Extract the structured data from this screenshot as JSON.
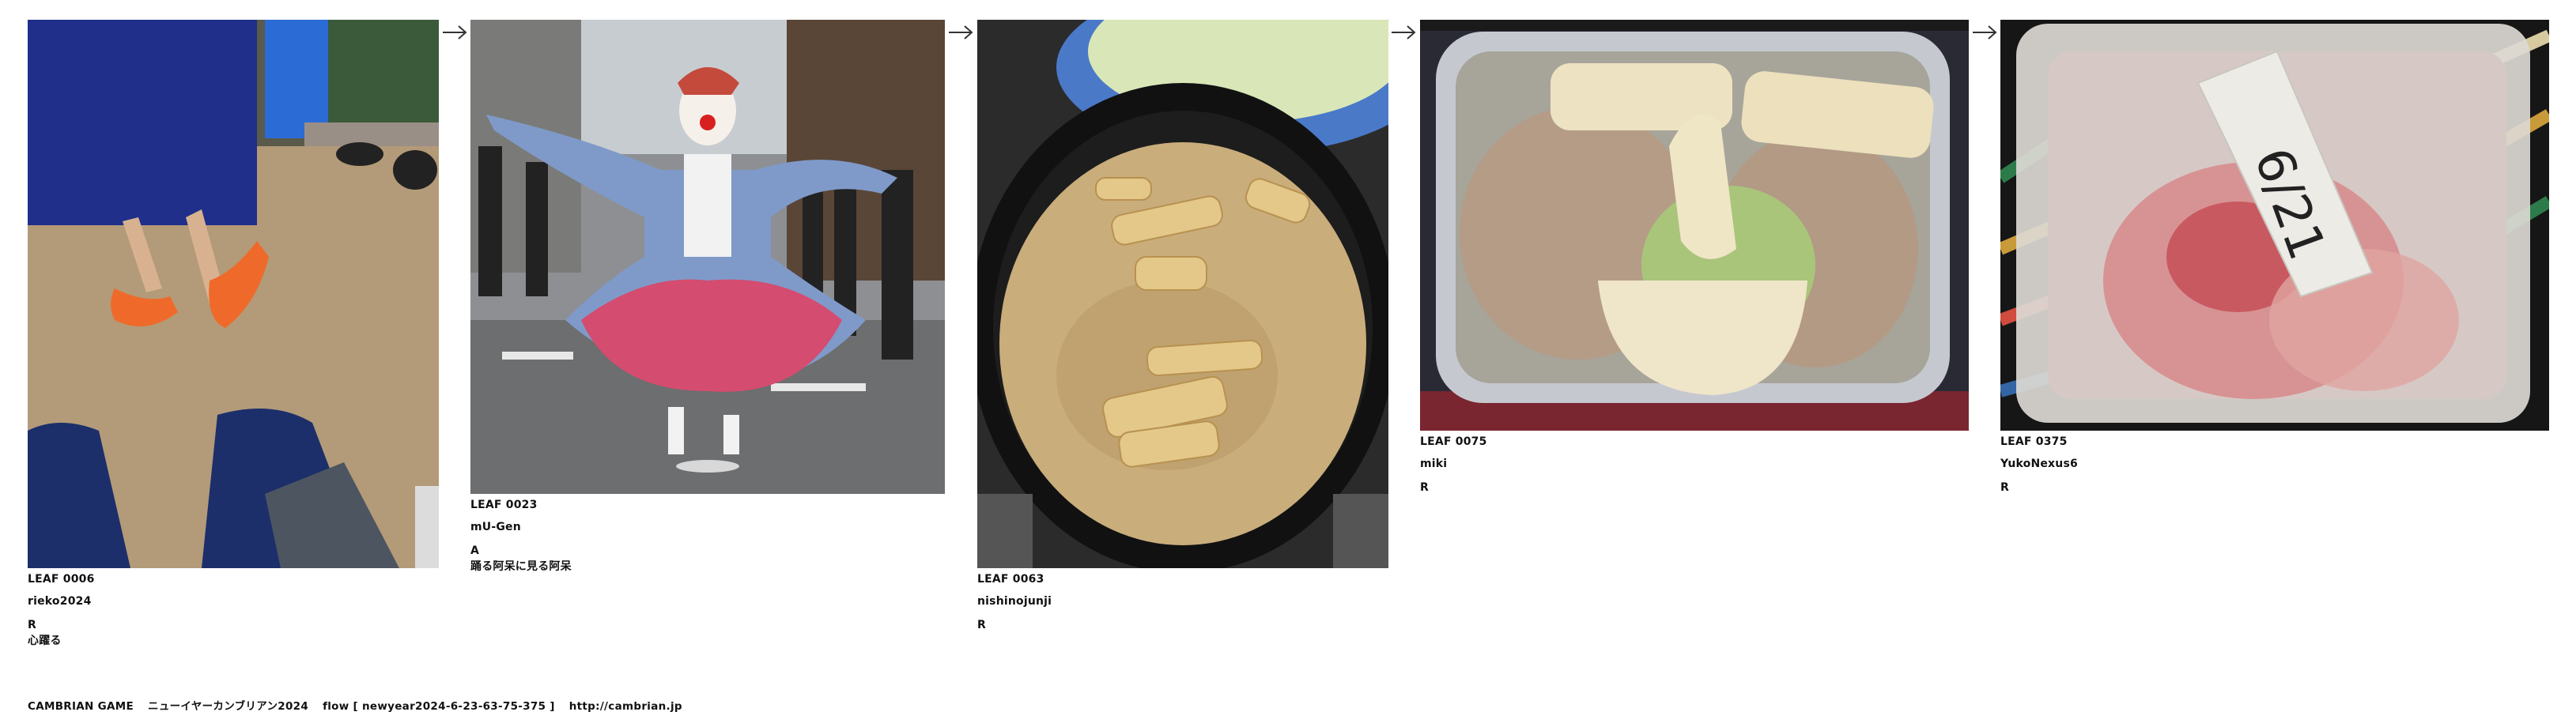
{
  "leaves": [
    {
      "id": "LEAF 0006",
      "author": "rieko2024",
      "rating": "R",
      "comment": "心躍る"
    },
    {
      "id": "LEAF 0023",
      "author": "mU-Gen",
      "rating": "A",
      "comment": "踊る阿呆に見る阿呆"
    },
    {
      "id": "LEAF 0063",
      "author": "nishinojunji",
      "rating": "R",
      "comment": ""
    },
    {
      "id": "LEAF 0075",
      "author": "miki",
      "rating": "R",
      "comment": ""
    },
    {
      "id": "LEAF 0375",
      "author": "YukoNexus6",
      "rating": "R",
      "comment": ""
    }
  ],
  "arrow_icon": "right-arrow-icon",
  "footer": {
    "game": "CAMBRIAN GAME",
    "title": "ニューイヤーカンブリアン2024",
    "flow": "flow [ newyear2024-6-23-63-75-375 ]",
    "url": "http://cambrian.jp"
  },
  "photo_labels": {
    "leaf_0375_tape": "6/21"
  }
}
